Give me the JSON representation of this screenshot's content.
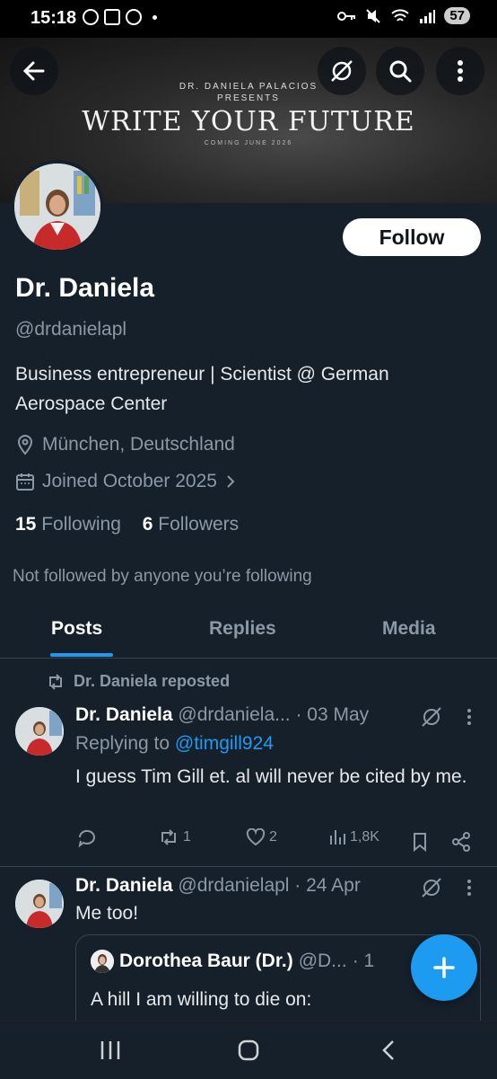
{
  "status_bar": {
    "time": "15:18",
    "battery": "57"
  },
  "banner": {
    "presenter_line1": "DR. DANIELA PALACIOS",
    "presenter_line2": "PRESENTS",
    "headline": "WRITE YOUR FUTURE",
    "subtext": "COMING JUNE 2026"
  },
  "header_icons": [
    "back-arrow-icon",
    "grok-icon",
    "search-icon",
    "more-vertical-icon"
  ],
  "profile": {
    "follow_label": "Follow",
    "name": "Dr. Daniela",
    "handle": "@drdanielapl",
    "bio": "Business entrepreneur | Scientist @ German Aerospace Center",
    "location": "München, Deutschland",
    "joined": "Joined October 2025",
    "following_count": "15",
    "following_label": "Following",
    "followers_count": "6",
    "followers_label": "Followers",
    "not_followed_text": "Not followed by anyone you’re following"
  },
  "tabs": [
    {
      "label": "Posts",
      "active": true
    },
    {
      "label": "Replies",
      "active": false
    },
    {
      "label": "Media",
      "active": false
    }
  ],
  "posts": [
    {
      "repost_label": "Dr. Daniela reposted",
      "author": "Dr. Daniela",
      "handle_date": "@drdaniela... · 03 May",
      "replying_prefix": "Replying to",
      "replying_handle": "@timgill924",
      "text": "I guess Tim Gill et. al will never be cited by me.",
      "replies": "",
      "reposts": "1",
      "likes": "2",
      "views": "1,8K"
    },
    {
      "author": "Dr. Daniela",
      "handle_date": "@drdanielapl · 24 Apr",
      "text": "Me too!",
      "quote": {
        "author": "Dorothea Baur (Dr.)",
        "handle": "@D...",
        "date_fragment": "· 1",
        "text": "A hill I am willing to die on:"
      }
    }
  ],
  "colors": {
    "accent": "#1d9bf0",
    "background": "#15202b",
    "muted": "#8b98a5",
    "divider": "#38444d"
  }
}
